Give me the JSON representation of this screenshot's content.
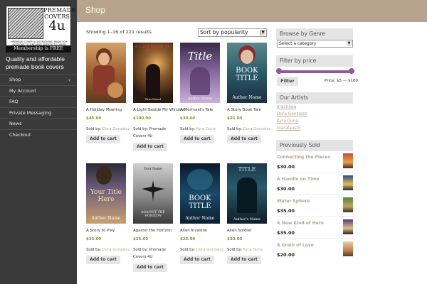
{
  "sidebar": {
    "logo": {
      "line1": "PREMADE",
      "line2": "COVERS",
      "line3": "4u",
      "tagline": "PREMADE COVER ILLUSTRATIONS, MADE FOR AUTHORS TO FIND AND ARTISTS TO OFFER",
      "membership": "Membership is FREE"
    },
    "description": "Quality and affordable premade book covers",
    "nav": [
      "Shop",
      "My Account",
      "FAQ",
      "Private Messaging",
      "News",
      "Checkout"
    ]
  },
  "header": {
    "title": "Shop"
  },
  "toolbar": {
    "result_count": "Showing 1–16 of 221 results",
    "sort_value": "Sort by popularity"
  },
  "products": [
    {
      "name": "A Holiday Meeting",
      "price": "$45.00",
      "seller_prefix": "Sold by:",
      "seller": "Dora Gonzalez",
      "button": "Add to cart"
    },
    {
      "name": "A Light Beside My Window",
      "price": "$100.00",
      "seller_prefix": "Sold by:",
      "seller": "Premade Covers 4U",
      "button": "Add to cart"
    },
    {
      "name": "A Mermaid's Tale",
      "price": "$30.00",
      "seller_prefix": "Sold by:",
      "seller": "Kyra Dune",
      "button": "Add to cart"
    },
    {
      "name": "A Story Book Tale",
      "price": "$35.00",
      "seller_prefix": "Sold by:",
      "seller": "Dora Gonzalez",
      "button": "Add to cart"
    },
    {
      "name": "A Story to Play",
      "price": "$35.00",
      "seller_prefix": "Sold by:",
      "seller": "Dora Gonzalez",
      "button": "Add to cart"
    },
    {
      "name": "Against the Horizon",
      "price": "$35.00",
      "seller_prefix": "Sold by:",
      "seller": "Premade Covers 4U",
      "button": "Add to cart"
    },
    {
      "name": "Alien Invasion",
      "price": "$25.00",
      "seller_prefix": "Sold by:",
      "seller": "Dora Gonzalez",
      "button": "Add to cart"
    },
    {
      "name": "Alien Soldier",
      "price": "$30.00",
      "seller_prefix": "Sold by:",
      "seller": "Kyra Dune",
      "button": "Add to cart"
    }
  ],
  "covers": [
    {
      "text": "",
      "sub": ""
    },
    {
      "text": "A Light Beside My Window",
      "sub": "Erin Novel"
    },
    {
      "text": "Title",
      "sub": "Author Name"
    },
    {
      "text": "BOOK TITLE",
      "sub": "Author Name"
    },
    {
      "text": "Your Title Here",
      "sub": "Author Name"
    },
    {
      "text": "Your Name",
      "sub": "AGAINST THE HORIZON"
    },
    {
      "text": "BOOK TITLE",
      "sub": "Author Name"
    },
    {
      "text": "TITLE",
      "sub": "Author's Name"
    }
  ],
  "widgets": {
    "genre": {
      "title": "Browse by Genre",
      "select": "Select a category"
    },
    "price": {
      "title": "Filter by price",
      "button": "Filter",
      "range": "Price: $5 — $160"
    },
    "artists": {
      "title": "Our Artists",
      "items": [
        "arachnea",
        "Dora Gonzalez",
        "Kyra Dune",
        "marafaust5"
      ]
    },
    "sold": {
      "title": "Previously Sold",
      "items": [
        {
          "title": "Connecting the Pieces",
          "price": "$30.00"
        },
        {
          "title": "A Handle on Time",
          "price": "$30.00"
        },
        {
          "title": "Water Sphere",
          "price": "$35.00"
        },
        {
          "title": "A New Kind of Hero",
          "price": "$35.00"
        },
        {
          "title": "A Grain of Love",
          "price": "$20.00"
        }
      ]
    }
  },
  "colors": {
    "accent": "#b8a48c",
    "price": "#7a9b2c",
    "slider": "#8e5b96",
    "sidebar": "#3a3a3a"
  }
}
